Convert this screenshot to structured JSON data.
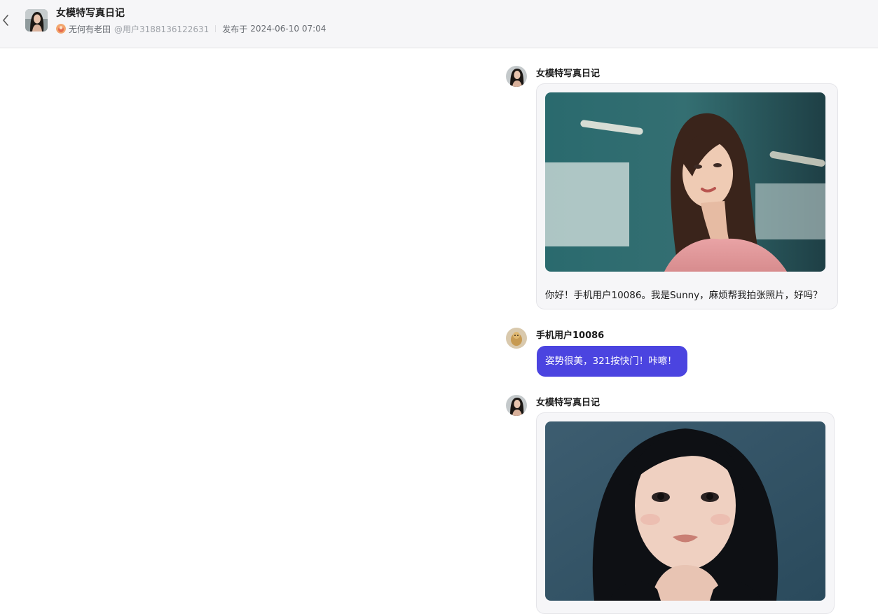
{
  "header": {
    "title": "女模特写真日记",
    "author_name": "无何有老田",
    "author_handle": "@用户3188136122631",
    "publish_label": "发布于",
    "publish_time": "2024-06-10 07:04"
  },
  "messages": [
    {
      "sender": "女模特写真日记",
      "text": "你好！手机用户10086。我是Sunny，麻烦帮我拍张照片，好吗？"
    },
    {
      "sender": "手机用户10086",
      "text": "姿势很美，321按快门！咔嚓！"
    },
    {
      "sender": "女模特写真日记",
      "text": ""
    }
  ],
  "icons": {
    "back": "chevron-left-icon",
    "author_badge": "author-avatar-icon"
  },
  "colors": {
    "accent": "#4b44e0",
    "header_bg": "#f6f6f8",
    "bubble_bg": "#f6f6f8"
  }
}
